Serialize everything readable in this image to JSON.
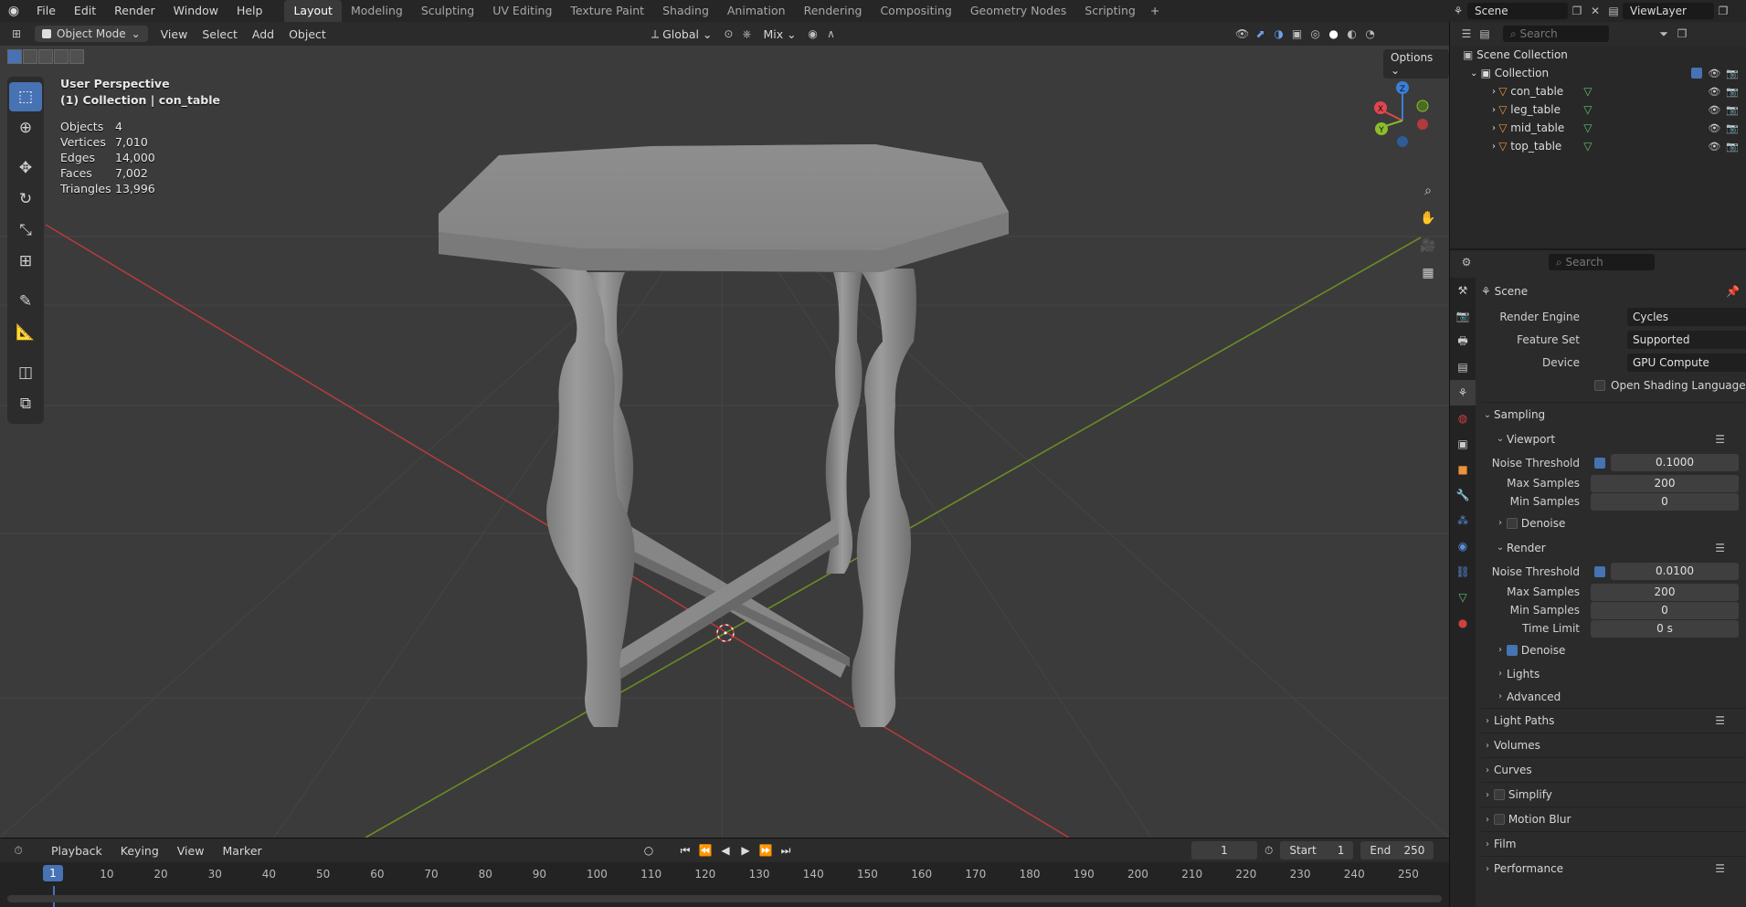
{
  "menu": [
    "File",
    "Edit",
    "Render",
    "Window",
    "Help"
  ],
  "workspaces": [
    "Layout",
    "Modeling",
    "Sculpting",
    "UV Editing",
    "Texture Paint",
    "Shading",
    "Animation",
    "Rendering",
    "Compositing",
    "Geometry Nodes",
    "Scripting"
  ],
  "workspace_active": "Layout",
  "workspace_add": "+",
  "scene_name": "Scene",
  "view_layer": "ViewLayer",
  "viewport": {
    "mode": "Object Mode",
    "menus": [
      "View",
      "Select",
      "Add",
      "Object"
    ],
    "orientation": "Global",
    "snap": "Mix",
    "options": "Options",
    "overlay_title": "User Perspective",
    "overlay_collection": "(1) Collection | con_table",
    "stats": [
      {
        "label": "Objects",
        "value": "4"
      },
      {
        "label": "Vertices",
        "value": "7,010"
      },
      {
        "label": "Edges",
        "value": "14,000"
      },
      {
        "label": "Faces",
        "value": "7,002"
      },
      {
        "label": "Triangles",
        "value": "13,996"
      }
    ],
    "gizmo_axes": {
      "x": "X",
      "y": "Y",
      "z": "Z"
    }
  },
  "outliner": {
    "search_placeholder": "Search",
    "scene_collection": "Scene Collection",
    "collection": "Collection",
    "objects": [
      "con_table",
      "leg_table",
      "mid_table",
      "top_table"
    ]
  },
  "properties": {
    "search_placeholder": "Search",
    "context": "Scene",
    "render_engine_label": "Render Engine",
    "render_engine": "Cycles",
    "feature_set_label": "Feature Set",
    "feature_set": "Supported",
    "device_label": "Device",
    "device": "GPU Compute",
    "osl": "Open Shading Language",
    "sampling": "Sampling",
    "viewport_sub": "Viewport",
    "vp_noise_threshold_label": "Noise Threshold",
    "vp_noise_threshold": "0.1000",
    "vp_max_samples_label": "Max Samples",
    "vp_max_samples": "200",
    "vp_min_samples_label": "Min Samples",
    "vp_min_samples": "0",
    "vp_denoise": "Denoise",
    "render_sub": "Render",
    "r_noise_threshold_label": "Noise Threshold",
    "r_noise_threshold": "0.0100",
    "r_max_samples_label": "Max Samples",
    "r_max_samples": "200",
    "r_min_samples_label": "Min Samples",
    "r_min_samples": "0",
    "r_time_limit_label": "Time Limit",
    "r_time_limit": "0 s",
    "r_denoise": "Denoise",
    "lights": "Lights",
    "advanced": "Advanced",
    "panels": [
      "Light Paths",
      "Volumes",
      "Curves",
      "Simplify",
      "Motion Blur",
      "Film",
      "Performance"
    ]
  },
  "timeline": {
    "menus": [
      "Playback",
      "Keying",
      "View",
      "Marker"
    ],
    "current_frame": "1",
    "start_label": "Start",
    "start": "1",
    "end_label": "End",
    "end": "250",
    "ticks": [
      "10",
      "20",
      "30",
      "40",
      "50",
      "60",
      "70",
      "80",
      "90",
      "100",
      "110",
      "120",
      "130",
      "140",
      "150",
      "160",
      "170",
      "180",
      "190",
      "200",
      "210",
      "220",
      "230",
      "240",
      "250"
    ]
  },
  "colors": {
    "accent": "#4772b3",
    "x_axis": "#e0464d",
    "y_axis": "#8bbd2d",
    "z_axis": "#3a7fd8"
  }
}
